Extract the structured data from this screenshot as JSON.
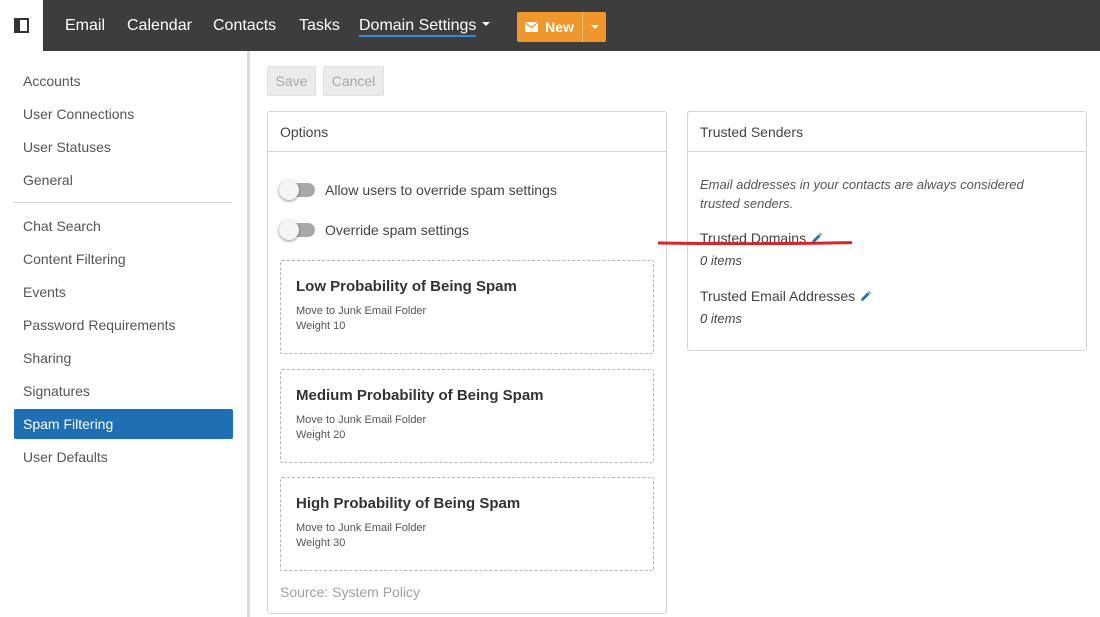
{
  "topbar": {
    "nav": [
      {
        "label": "Email"
      },
      {
        "label": "Calendar"
      },
      {
        "label": "Contacts"
      },
      {
        "label": "Tasks"
      },
      {
        "label": "Domain Settings"
      }
    ],
    "new_label": "New"
  },
  "sidebar": {
    "group1": [
      {
        "label": "Accounts"
      },
      {
        "label": "User Connections"
      },
      {
        "label": "User Statuses"
      },
      {
        "label": "General"
      }
    ],
    "group2": [
      {
        "label": "Chat Search"
      },
      {
        "label": "Content Filtering"
      },
      {
        "label": "Events"
      },
      {
        "label": "Password Requirements"
      },
      {
        "label": "Sharing"
      },
      {
        "label": "Signatures"
      },
      {
        "label": "Spam Filtering"
      },
      {
        "label": "User Defaults"
      }
    ]
  },
  "toolbar": {
    "save_label": "Save",
    "cancel_label": "Cancel"
  },
  "options": {
    "title": "Options",
    "toggle_allow": "Allow users to override spam settings",
    "toggle_override": "Override spam settings",
    "levels": [
      {
        "title": "Low Probability of Being Spam",
        "action": "Move to Junk Email Folder",
        "weight": "Weight 10"
      },
      {
        "title": "Medium Probability of Being Spam",
        "action": "Move to Junk Email Folder",
        "weight": "Weight 20"
      },
      {
        "title": "High Probability of Being Spam",
        "action": "Move to Junk Email Folder",
        "weight": "Weight 30"
      }
    ],
    "source": "Source: System Policy"
  },
  "trusted": {
    "title": "Trusted Senders",
    "description": "Email addresses in your contacts are always considered trusted senders.",
    "domains_label": "Trusted Domains",
    "domains_count": "0 items",
    "addresses_label": "Trusted Email Addresses",
    "addresses_count": "0 items"
  },
  "colors": {
    "topbar": "#3d3d3d",
    "accent_orange": "#f0962a",
    "selected_blue": "#1f6fb5",
    "annotation_red": "#d6252b"
  },
  "icons": {
    "sidebar_toggle": "panel-left-icon",
    "new": "envelope-icon",
    "edit": "pencil-icon"
  }
}
